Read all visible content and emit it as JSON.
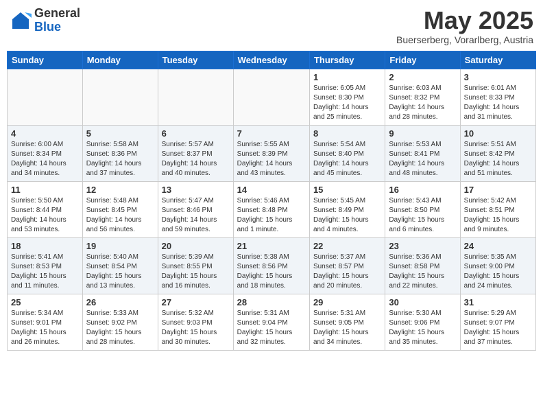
{
  "header": {
    "logo_general": "General",
    "logo_blue": "Blue",
    "month_title": "May 2025",
    "subtitle": "Buerserberg, Vorarlberg, Austria"
  },
  "weekdays": [
    "Sunday",
    "Monday",
    "Tuesday",
    "Wednesday",
    "Thursday",
    "Friday",
    "Saturday"
  ],
  "weeks": [
    [
      {
        "day": "",
        "info": ""
      },
      {
        "day": "",
        "info": ""
      },
      {
        "day": "",
        "info": ""
      },
      {
        "day": "",
        "info": ""
      },
      {
        "day": "1",
        "info": "Sunrise: 6:05 AM\nSunset: 8:30 PM\nDaylight: 14 hours\nand 25 minutes."
      },
      {
        "day": "2",
        "info": "Sunrise: 6:03 AM\nSunset: 8:32 PM\nDaylight: 14 hours\nand 28 minutes."
      },
      {
        "day": "3",
        "info": "Sunrise: 6:01 AM\nSunset: 8:33 PM\nDaylight: 14 hours\nand 31 minutes."
      }
    ],
    [
      {
        "day": "4",
        "info": "Sunrise: 6:00 AM\nSunset: 8:34 PM\nDaylight: 14 hours\nand 34 minutes."
      },
      {
        "day": "5",
        "info": "Sunrise: 5:58 AM\nSunset: 8:36 PM\nDaylight: 14 hours\nand 37 minutes."
      },
      {
        "day": "6",
        "info": "Sunrise: 5:57 AM\nSunset: 8:37 PM\nDaylight: 14 hours\nand 40 minutes."
      },
      {
        "day": "7",
        "info": "Sunrise: 5:55 AM\nSunset: 8:39 PM\nDaylight: 14 hours\nand 43 minutes."
      },
      {
        "day": "8",
        "info": "Sunrise: 5:54 AM\nSunset: 8:40 PM\nDaylight: 14 hours\nand 45 minutes."
      },
      {
        "day": "9",
        "info": "Sunrise: 5:53 AM\nSunset: 8:41 PM\nDaylight: 14 hours\nand 48 minutes."
      },
      {
        "day": "10",
        "info": "Sunrise: 5:51 AM\nSunset: 8:42 PM\nDaylight: 14 hours\nand 51 minutes."
      }
    ],
    [
      {
        "day": "11",
        "info": "Sunrise: 5:50 AM\nSunset: 8:44 PM\nDaylight: 14 hours\nand 53 minutes."
      },
      {
        "day": "12",
        "info": "Sunrise: 5:48 AM\nSunset: 8:45 PM\nDaylight: 14 hours\nand 56 minutes."
      },
      {
        "day": "13",
        "info": "Sunrise: 5:47 AM\nSunset: 8:46 PM\nDaylight: 14 hours\nand 59 minutes."
      },
      {
        "day": "14",
        "info": "Sunrise: 5:46 AM\nSunset: 8:48 PM\nDaylight: 15 hours\nand 1 minute."
      },
      {
        "day": "15",
        "info": "Sunrise: 5:45 AM\nSunset: 8:49 PM\nDaylight: 15 hours\nand 4 minutes."
      },
      {
        "day": "16",
        "info": "Sunrise: 5:43 AM\nSunset: 8:50 PM\nDaylight: 15 hours\nand 6 minutes."
      },
      {
        "day": "17",
        "info": "Sunrise: 5:42 AM\nSunset: 8:51 PM\nDaylight: 15 hours\nand 9 minutes."
      }
    ],
    [
      {
        "day": "18",
        "info": "Sunrise: 5:41 AM\nSunset: 8:53 PM\nDaylight: 15 hours\nand 11 minutes."
      },
      {
        "day": "19",
        "info": "Sunrise: 5:40 AM\nSunset: 8:54 PM\nDaylight: 15 hours\nand 13 minutes."
      },
      {
        "day": "20",
        "info": "Sunrise: 5:39 AM\nSunset: 8:55 PM\nDaylight: 15 hours\nand 16 minutes."
      },
      {
        "day": "21",
        "info": "Sunrise: 5:38 AM\nSunset: 8:56 PM\nDaylight: 15 hours\nand 18 minutes."
      },
      {
        "day": "22",
        "info": "Sunrise: 5:37 AM\nSunset: 8:57 PM\nDaylight: 15 hours\nand 20 minutes."
      },
      {
        "day": "23",
        "info": "Sunrise: 5:36 AM\nSunset: 8:58 PM\nDaylight: 15 hours\nand 22 minutes."
      },
      {
        "day": "24",
        "info": "Sunrise: 5:35 AM\nSunset: 9:00 PM\nDaylight: 15 hours\nand 24 minutes."
      }
    ],
    [
      {
        "day": "25",
        "info": "Sunrise: 5:34 AM\nSunset: 9:01 PM\nDaylight: 15 hours\nand 26 minutes."
      },
      {
        "day": "26",
        "info": "Sunrise: 5:33 AM\nSunset: 9:02 PM\nDaylight: 15 hours\nand 28 minutes."
      },
      {
        "day": "27",
        "info": "Sunrise: 5:32 AM\nSunset: 9:03 PM\nDaylight: 15 hours\nand 30 minutes."
      },
      {
        "day": "28",
        "info": "Sunrise: 5:31 AM\nSunset: 9:04 PM\nDaylight: 15 hours\nand 32 minutes."
      },
      {
        "day": "29",
        "info": "Sunrise: 5:31 AM\nSunset: 9:05 PM\nDaylight: 15 hours\nand 34 minutes."
      },
      {
        "day": "30",
        "info": "Sunrise: 5:30 AM\nSunset: 9:06 PM\nDaylight: 15 hours\nand 35 minutes."
      },
      {
        "day": "31",
        "info": "Sunrise: 5:29 AM\nSunset: 9:07 PM\nDaylight: 15 hours\nand 37 minutes."
      }
    ]
  ]
}
